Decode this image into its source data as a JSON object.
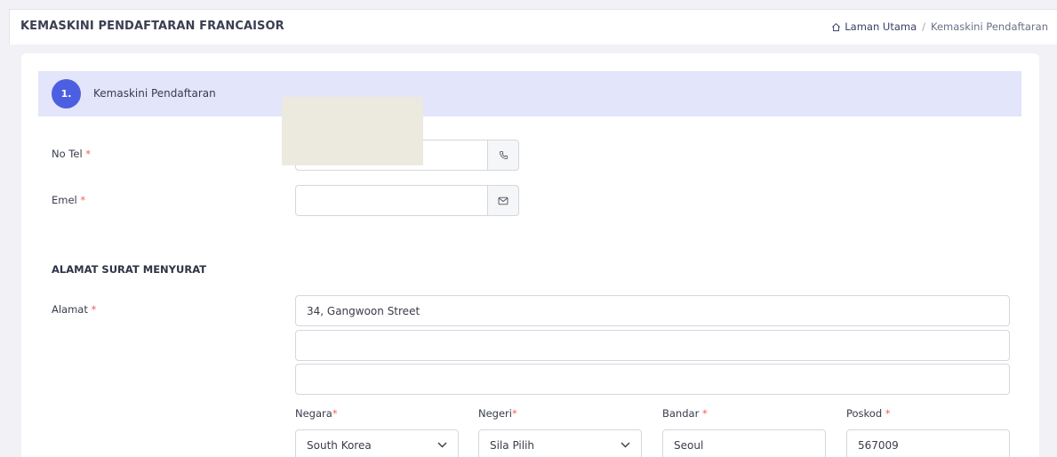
{
  "header": {
    "title": "KEMASKINI PENDAFTARAN FRANCAISOR",
    "breadcrumb": {
      "home": "Laman Utama",
      "separator": "/",
      "current": "Kemaskini Pendaftaran"
    }
  },
  "step": {
    "number": "1.",
    "label": "Kemaskini Pendaftaran"
  },
  "form": {
    "required_mark": "*",
    "no_tel": {
      "label": "No Tel",
      "value": "",
      "icon": "phone-icon"
    },
    "emel": {
      "label": "Emel",
      "value": "",
      "icon": "mail-icon"
    },
    "section_title": "ALAMAT SURAT MENYURAT",
    "alamat": {
      "label": "Alamat",
      "line1": "34, Gangwoon Street",
      "line2": "",
      "line3": ""
    },
    "negara": {
      "label": "Negara",
      "value": "South Korea"
    },
    "negeri": {
      "label": "Negeri",
      "value": "Sila Pilih"
    },
    "bandar": {
      "label": "Bandar",
      "value": "Seoul"
    },
    "poskod": {
      "label": "Poskod",
      "value": "567009"
    }
  },
  "colors": {
    "accent": "#4d5fe1",
    "step_bg": "#e3e5fb",
    "required": "#f35d5d",
    "redaction": "#ece9df"
  }
}
